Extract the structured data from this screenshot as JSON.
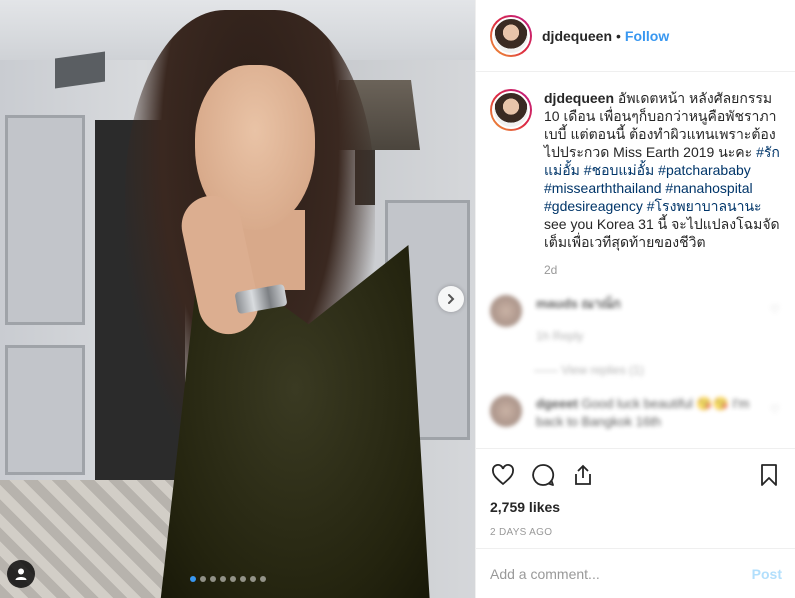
{
  "post": {
    "username": "djdequeen",
    "follow_label": "Follow",
    "separator": "•",
    "caption_text": "อัพเดตหน้า หลังศัลยกรรม 10 เดือน เพื่อนๆก็บอกว่าหนูคือพัชราภาเบบี้ แต่ตอนนี้ ต้องทำผิวแทนเพราะต้องไปประกวด Miss Earth 2019 นะคะ ",
    "hashtags_1": [
      "#รักแม่อั้ม",
      "#ชอบแม่อั้ม",
      "#patcharababy",
      "#missearththailand",
      "#nanahospital",
      "#gdesireagency",
      "#โรงพยาบาลนานะ"
    ],
    "caption_tail": " see you Korea 31 นี้ จะไปแปลงโฉมจัดเต็มเพื่อเวทีสุดท้ายของชีวิต",
    "caption_age": "2d",
    "likes": "2,759 likes",
    "date": "2 DAYS AGO"
  },
  "comments": [
    {
      "user": "mauds ณาณ็ก",
      "text": "",
      "meta": "1h   Reply"
    },
    {
      "user": "dgeeet",
      "text": "Good luck beautiful 😘😘 I'm back to Bangkok 16th",
      "meta": ""
    }
  ],
  "view_replies": "View replies (1)",
  "input": {
    "placeholder": "Add a comment...",
    "post_label": "Post"
  },
  "icons": {
    "like": "heart-icon",
    "comment": "comment-bubble-icon",
    "share": "share-icon",
    "save": "bookmark-icon",
    "next": "chevron-right-icon",
    "user_tags": "user-icon"
  },
  "carousel": {
    "count": 8,
    "active": 0
  },
  "colors": {
    "accent": "#3897f0",
    "post_disabled": "#b2dffc",
    "hashtag": "#003569",
    "muted": "#999999"
  }
}
